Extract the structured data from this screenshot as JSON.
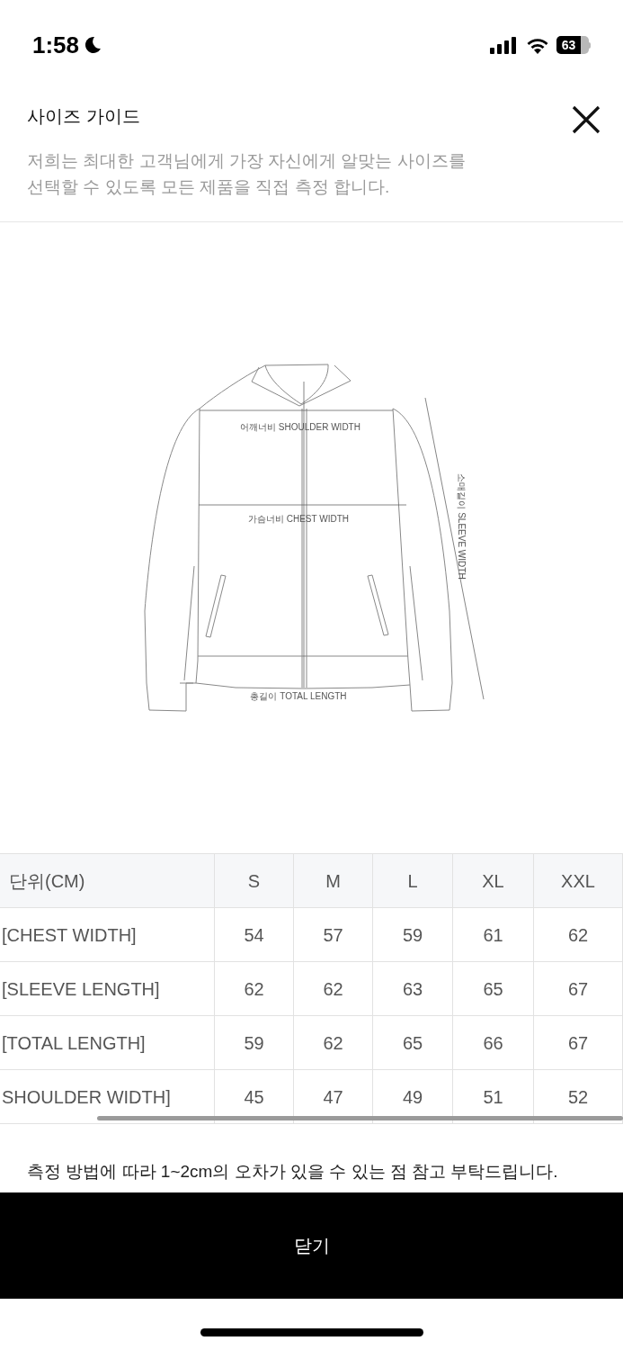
{
  "status_bar": {
    "time": "1:58",
    "battery": "63"
  },
  "header": {
    "title": "사이즈 가이드",
    "description_lines": [
      "저희는 최대한 고객님에게 가장 자신에게 알맞는 사이즈를",
      "선택할 수 있도록 모든 제품을 직접 측정 합니다."
    ]
  },
  "diagram": {
    "labels": [
      {
        "kind": "shoulder",
        "text": "어깨너비 SHOULDER WIDTH"
      },
      {
        "kind": "chest",
        "text": "가슴너비 CHEST WIDTH"
      },
      {
        "kind": "sleeve",
        "text": "소매길이 SLEEVE WIDTH"
      },
      {
        "kind": "length",
        "text": "총길이 TOTAL LENGTH"
      }
    ]
  },
  "size_table": {
    "columns": [
      "단위(CM)",
      "S",
      "M",
      "L",
      "XL",
      "XXL"
    ],
    "rows": [
      {
        "label": "[CHEST WIDTH]",
        "values": [
          "54",
          "57",
          "59",
          "61",
          "62"
        ]
      },
      {
        "label": "[SLEEVE LENGTH]",
        "values": [
          "62",
          "62",
          "63",
          "65",
          "67"
        ]
      },
      {
        "label": "[TOTAL LENGTH]",
        "values": [
          "59",
          "62",
          "65",
          "66",
          "67"
        ]
      },
      {
        "label": "SHOULDER WIDTH]",
        "values": [
          "45",
          "47",
          "49",
          "51",
          "52"
        ]
      }
    ]
  },
  "note": "측정 방법에 따라 1~2cm의 오차가 있을 수 있는 점 참고 부탁드립니다.",
  "close_button": "닫기"
}
